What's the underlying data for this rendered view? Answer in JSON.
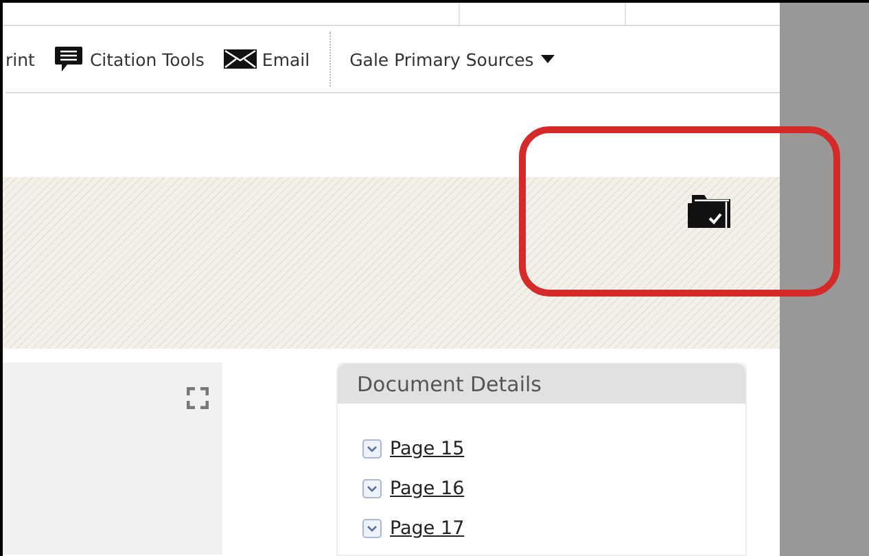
{
  "toolbar": {
    "items": [
      {
        "label": "rint",
        "kind": "plain"
      },
      {
        "label": "Citation Tools",
        "kind": "comment"
      },
      {
        "label": "Email",
        "kind": "mail"
      },
      {
        "label": "Gale Primary Sources",
        "kind": "menu"
      }
    ]
  },
  "document_details": {
    "title": "Document Details",
    "pages": [
      {
        "label": "Page 15"
      },
      {
        "label": "Page 16"
      },
      {
        "label": "Page 17"
      }
    ]
  }
}
